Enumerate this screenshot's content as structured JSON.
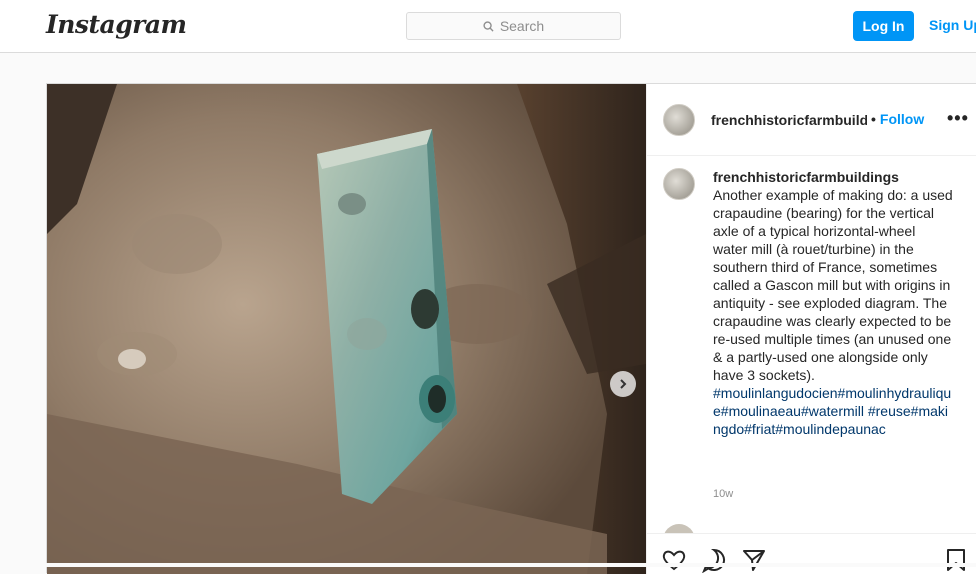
{
  "header": {
    "logo": "Instagram",
    "search_placeholder": "Search",
    "login_label": "Log In",
    "signup_label": "Sign Up"
  },
  "post": {
    "username": "frenchhistoricfarmbuildings",
    "follow_label": "Follow",
    "separator": "•",
    "more_label": "•••",
    "caption": "Another example of making do: a used crapaudine (bearing) for the vertical axle of a typical horizontal-wheel water mill (à rouet/turbine) in the southern third of France, sometimes called a Gascon mill but with origins in antiquity - see exploded diagram. The crapaudine was clearly expected to be re-used multiple times (an unused one & a partly-used one alongside only have 3 sockets).",
    "hashtags": "#moulinlangudocien#moulinhydraulique#moulinaeau#watermill #reuse#makingdo#friat#moulindepaunac",
    "age": "10w"
  },
  "icons": [
    "search-icon",
    "chevron-right-icon",
    "heart-icon",
    "comment-icon",
    "share-icon",
    "bookmark-icon",
    "more-icon"
  ],
  "colors": {
    "accent": "#0095f6",
    "hashtag": "#00376b",
    "border": "#dbdbdb"
  }
}
